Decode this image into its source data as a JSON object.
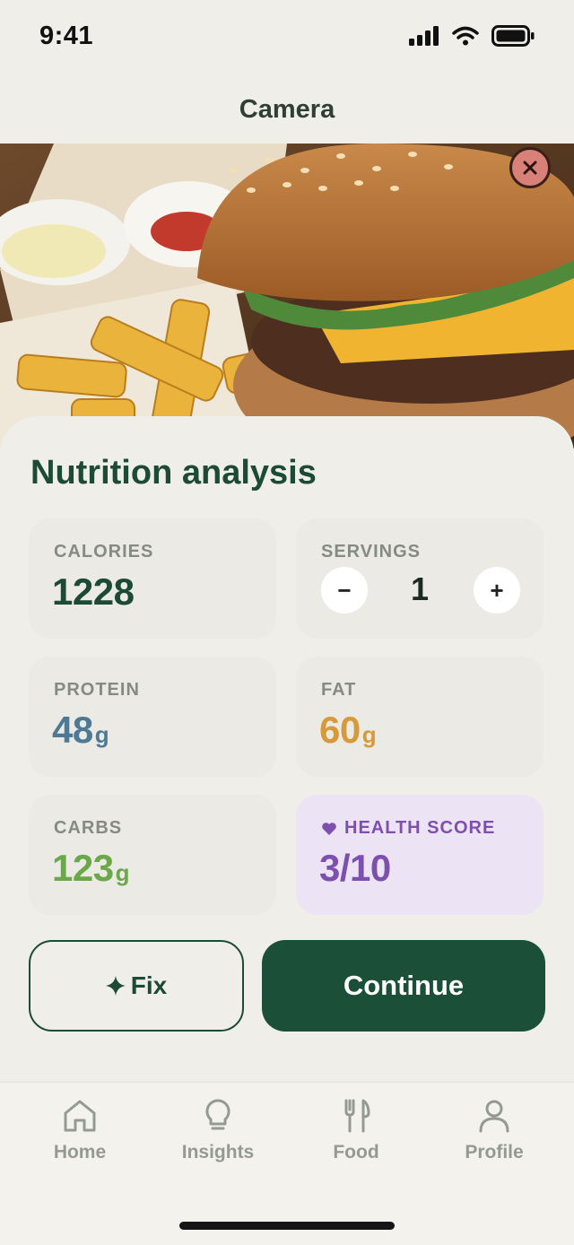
{
  "status_bar": {
    "time": "9:41"
  },
  "header": {
    "title": "Camera"
  },
  "photo": {
    "subject": "burger-with-fries-photo"
  },
  "sheet": {
    "title": "Nutrition analysis",
    "calories": {
      "label": "CALORIES",
      "value": "1228"
    },
    "servings": {
      "label": "SERVINGS",
      "value": "1",
      "minus": "−",
      "plus": "+"
    },
    "protein": {
      "label": "PROTEIN",
      "value": "48",
      "unit": "g"
    },
    "fat": {
      "label": "FAT",
      "value": "60",
      "unit": "g"
    },
    "carbs": {
      "label": "CARBS",
      "value": "123",
      "unit": "g"
    },
    "health": {
      "label": "HEALTH SCORE",
      "value": "3/10"
    },
    "fix_label": "Fix",
    "continue_label": "Continue"
  },
  "tabbar": {
    "items": [
      {
        "label": "Home",
        "icon": "home-icon"
      },
      {
        "label": "Insights",
        "icon": "lightbulb-icon"
      },
      {
        "label": "Food",
        "icon": "fork-knife-icon"
      },
      {
        "label": "Profile",
        "icon": "person-icon"
      }
    ]
  },
  "colors": {
    "brand": "#1c4f37",
    "protein": "#4d7994",
    "fat": "#d8993a",
    "carbs": "#6aa84a",
    "health": "#7d4fae",
    "health_bg": "#ece4f4"
  }
}
